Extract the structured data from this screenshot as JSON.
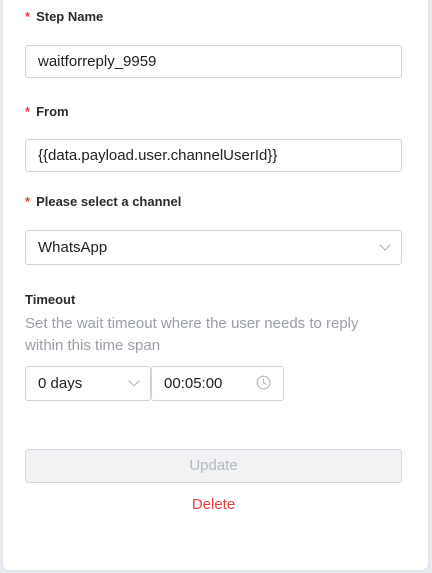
{
  "form": {
    "required_marker": "*",
    "step_name": {
      "label": "Step Name",
      "value": "waitforreply_9959"
    },
    "from": {
      "label": "From",
      "value": "{{data.payload.user.channelUserId}}"
    },
    "channel": {
      "label": "Please select a channel",
      "value": "WhatsApp"
    },
    "timeout": {
      "label": "Timeout",
      "help": "Set the wait timeout where the user needs to reply within this time span",
      "days_value": "0 days",
      "time_value": "00:05:00"
    }
  },
  "actions": {
    "update_label": "Update",
    "delete_label": "Delete"
  },
  "colors": {
    "required": "#e8413d",
    "delete": "#e8413d",
    "help_text": "#9a9ea8",
    "disabled_button_bg": "#f1f2f4"
  }
}
